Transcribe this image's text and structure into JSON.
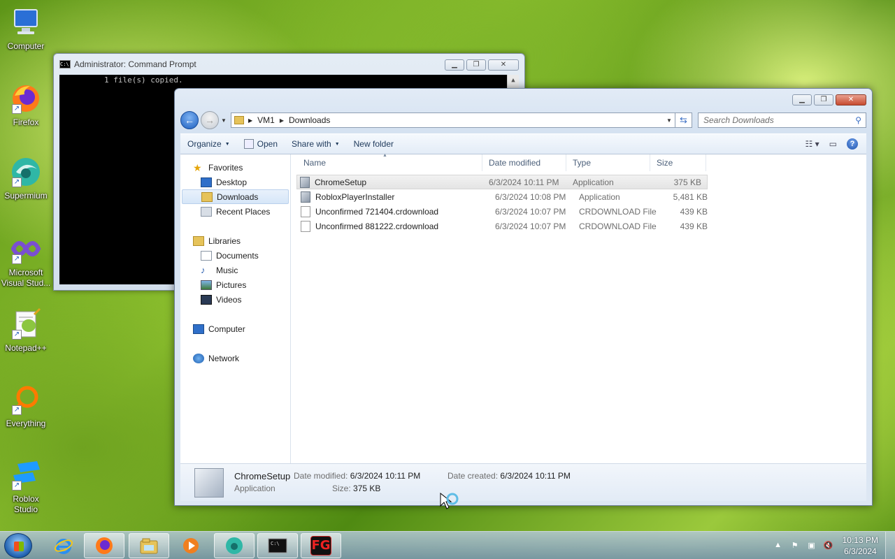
{
  "desktop_icons": [
    {
      "label": "Computer",
      "icon": "computer-icon"
    },
    {
      "label": "Firefox",
      "icon": "firefox-icon"
    },
    {
      "label": "Supermium",
      "icon": "supermium-icon"
    },
    {
      "label": "Microsoft Visual Stud...",
      "icon": "visual-studio-icon"
    },
    {
      "label": "Notepad++",
      "icon": "notepadpp-icon"
    },
    {
      "label": "Everything",
      "icon": "everything-icon"
    },
    {
      "label": "Roblox Studio",
      "icon": "roblox-studio-icon"
    }
  ],
  "cmd": {
    "title": "Administrator: Command Prompt",
    "output": "1 file(s) copied."
  },
  "explorer": {
    "breadcrumb": [
      "VM1",
      "Downloads"
    ],
    "search_placeholder": "Search Downloads",
    "toolbar": {
      "organize": "Organize",
      "open": "Open",
      "share_with": "Share with",
      "new_folder": "New folder"
    },
    "nav": {
      "favorites": "Favorites",
      "desktop": "Desktop",
      "downloads": "Downloads",
      "recent_places": "Recent Places",
      "libraries": "Libraries",
      "documents": "Documents",
      "music": "Music",
      "pictures": "Pictures",
      "videos": "Videos",
      "computer": "Computer",
      "network": "Network"
    },
    "columns": {
      "name": "Name",
      "date": "Date modified",
      "type": "Type",
      "size": "Size"
    },
    "files": [
      {
        "name": "ChromeSetup",
        "date": "6/3/2024 10:11 PM",
        "type": "Application",
        "size": "375 KB",
        "icon": "app-icon"
      },
      {
        "name": "RobloxPlayerInstaller",
        "date": "6/3/2024 10:08 PM",
        "type": "Application",
        "size": "5,481 KB",
        "icon": "app-icon"
      },
      {
        "name": "Unconfirmed 721404.crdownload",
        "date": "6/3/2024 10:07 PM",
        "type": "CRDOWNLOAD File",
        "size": "439 KB",
        "icon": "file-icon"
      },
      {
        "name": "Unconfirmed 881222.crdownload",
        "date": "6/3/2024 10:07 PM",
        "type": "CRDOWNLOAD File",
        "size": "439 KB",
        "icon": "file-icon"
      }
    ],
    "details": {
      "name": "ChromeSetup",
      "type": "Application",
      "modified_label": "Date modified:",
      "modified_value": "6/3/2024 10:11 PM",
      "created_label": "Date created:",
      "created_value": "6/3/2024 10:11 PM",
      "size_label": "Size:",
      "size_value": "375 KB"
    }
  },
  "taskbar": {
    "apps": [
      "internet-explorer-icon",
      "firefox-icon",
      "explorer-icon",
      "media-player-icon",
      "supermium-icon",
      "cmd-icon",
      "fg-icon"
    ],
    "fg_label": "FG",
    "clock_time": "10:13 PM",
    "clock_date": "6/3/2024"
  }
}
